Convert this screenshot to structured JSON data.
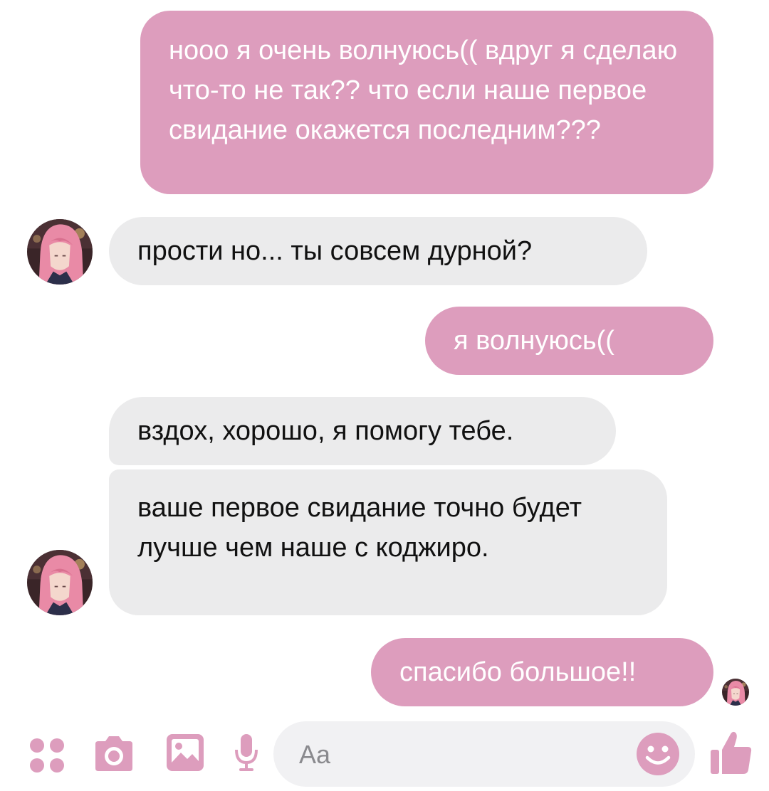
{
  "accent_color": "#dd9dbd",
  "messages": [
    {
      "direction": "outgoing",
      "text": "нооо я очень волнуюсь(( вдруг я сделаю что-то не так?? что если наше первое свидание окажется последним???"
    },
    {
      "direction": "incoming",
      "text": "прости но... ты совсем дурной?"
    },
    {
      "direction": "outgoing",
      "text": "я волнуюсь(("
    },
    {
      "direction": "incoming",
      "text": "вздох, хорошо, я помогу тебе."
    },
    {
      "direction": "incoming",
      "text": "ваше первое свидание точно будет лучше чем наше с коджиро."
    },
    {
      "direction": "outgoing",
      "text": "спасибо большое!!"
    }
  ],
  "composer": {
    "placeholder": "Aa",
    "icons": [
      "apps-icon",
      "camera-icon",
      "gallery-icon",
      "microphone-icon",
      "emoji-icon",
      "thumbs-up-icon"
    ]
  }
}
